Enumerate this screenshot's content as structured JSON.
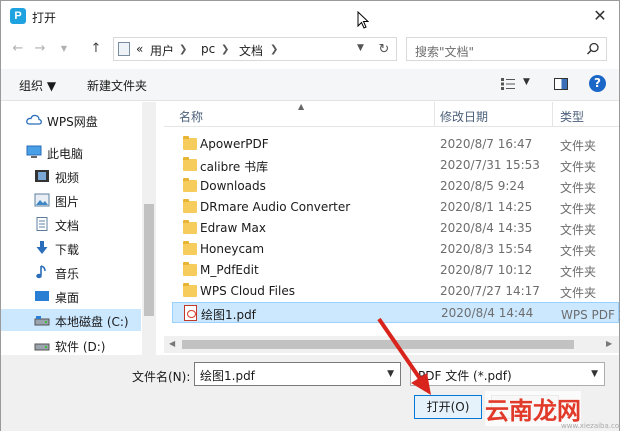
{
  "window": {
    "title": "打开",
    "app_badge": "P"
  },
  "address": {
    "prefix": "«",
    "crumbs": [
      "用户",
      "pc",
      "文档"
    ],
    "search_placeholder": "搜索\"文档\""
  },
  "commands": {
    "organize": "组织 ▼",
    "new_folder": "新建文件夹",
    "help": "?"
  },
  "nav": {
    "items": [
      {
        "label": "WPS网盘",
        "icon": "cloud-icon"
      },
      {
        "label": "此电脑",
        "icon": "computer-icon"
      },
      {
        "label": "视频",
        "icon": "video-icon"
      },
      {
        "label": "图片",
        "icon": "picture-icon"
      },
      {
        "label": "文档",
        "icon": "document-icon"
      },
      {
        "label": "下载",
        "icon": "download-icon"
      },
      {
        "label": "音乐",
        "icon": "music-icon"
      },
      {
        "label": "桌面",
        "icon": "desktop-icon"
      },
      {
        "label": "本地磁盘 (C:)",
        "icon": "drive-icon"
      },
      {
        "label": "软件 (D:)",
        "icon": "drive-icon"
      }
    ]
  },
  "columns": {
    "name": "名称",
    "date": "修改日期",
    "type": "类型"
  },
  "files": [
    {
      "name": "ApowerPDF",
      "date": "2020/8/7 16:47",
      "type": "文件夹",
      "kind": "folder"
    },
    {
      "name": "calibre 书库",
      "date": "2020/7/31 15:53",
      "type": "文件夹",
      "kind": "folder"
    },
    {
      "name": "Downloads",
      "date": "2020/8/5 9:24",
      "type": "文件夹",
      "kind": "folder"
    },
    {
      "name": "DRmare Audio Converter",
      "date": "2020/8/1 14:25",
      "type": "文件夹",
      "kind": "folder"
    },
    {
      "name": "Edraw Max",
      "date": "2020/8/4 14:35",
      "type": "文件夹",
      "kind": "folder"
    },
    {
      "name": "Honeycam",
      "date": "2020/8/3 15:54",
      "type": "文件夹",
      "kind": "folder"
    },
    {
      "name": "M_PdfEdit",
      "date": "2020/8/7 10:12",
      "type": "文件夹",
      "kind": "folder"
    },
    {
      "name": "WPS Cloud Files",
      "date": "2020/7/27 14:17",
      "type": "文件夹",
      "kind": "folder"
    },
    {
      "name": "绘图1.pdf",
      "date": "2020/8/4 14:44",
      "type": "WPS PDF 文",
      "kind": "pdf"
    }
  ],
  "footer": {
    "filename_label": "文件名(N):",
    "filename_value": "绘图1.pdf",
    "filetype_value": "PDF 文件 (*.pdf)",
    "open_label": "打开(O)"
  },
  "watermark": {
    "text": "云南龙网",
    "url": "www.xiezaiba.com"
  },
  "colors": {
    "accent": "#0078d7",
    "selection": "#cce8ff",
    "folder": "#f6cd5c",
    "annotation": "#e23a2a"
  }
}
